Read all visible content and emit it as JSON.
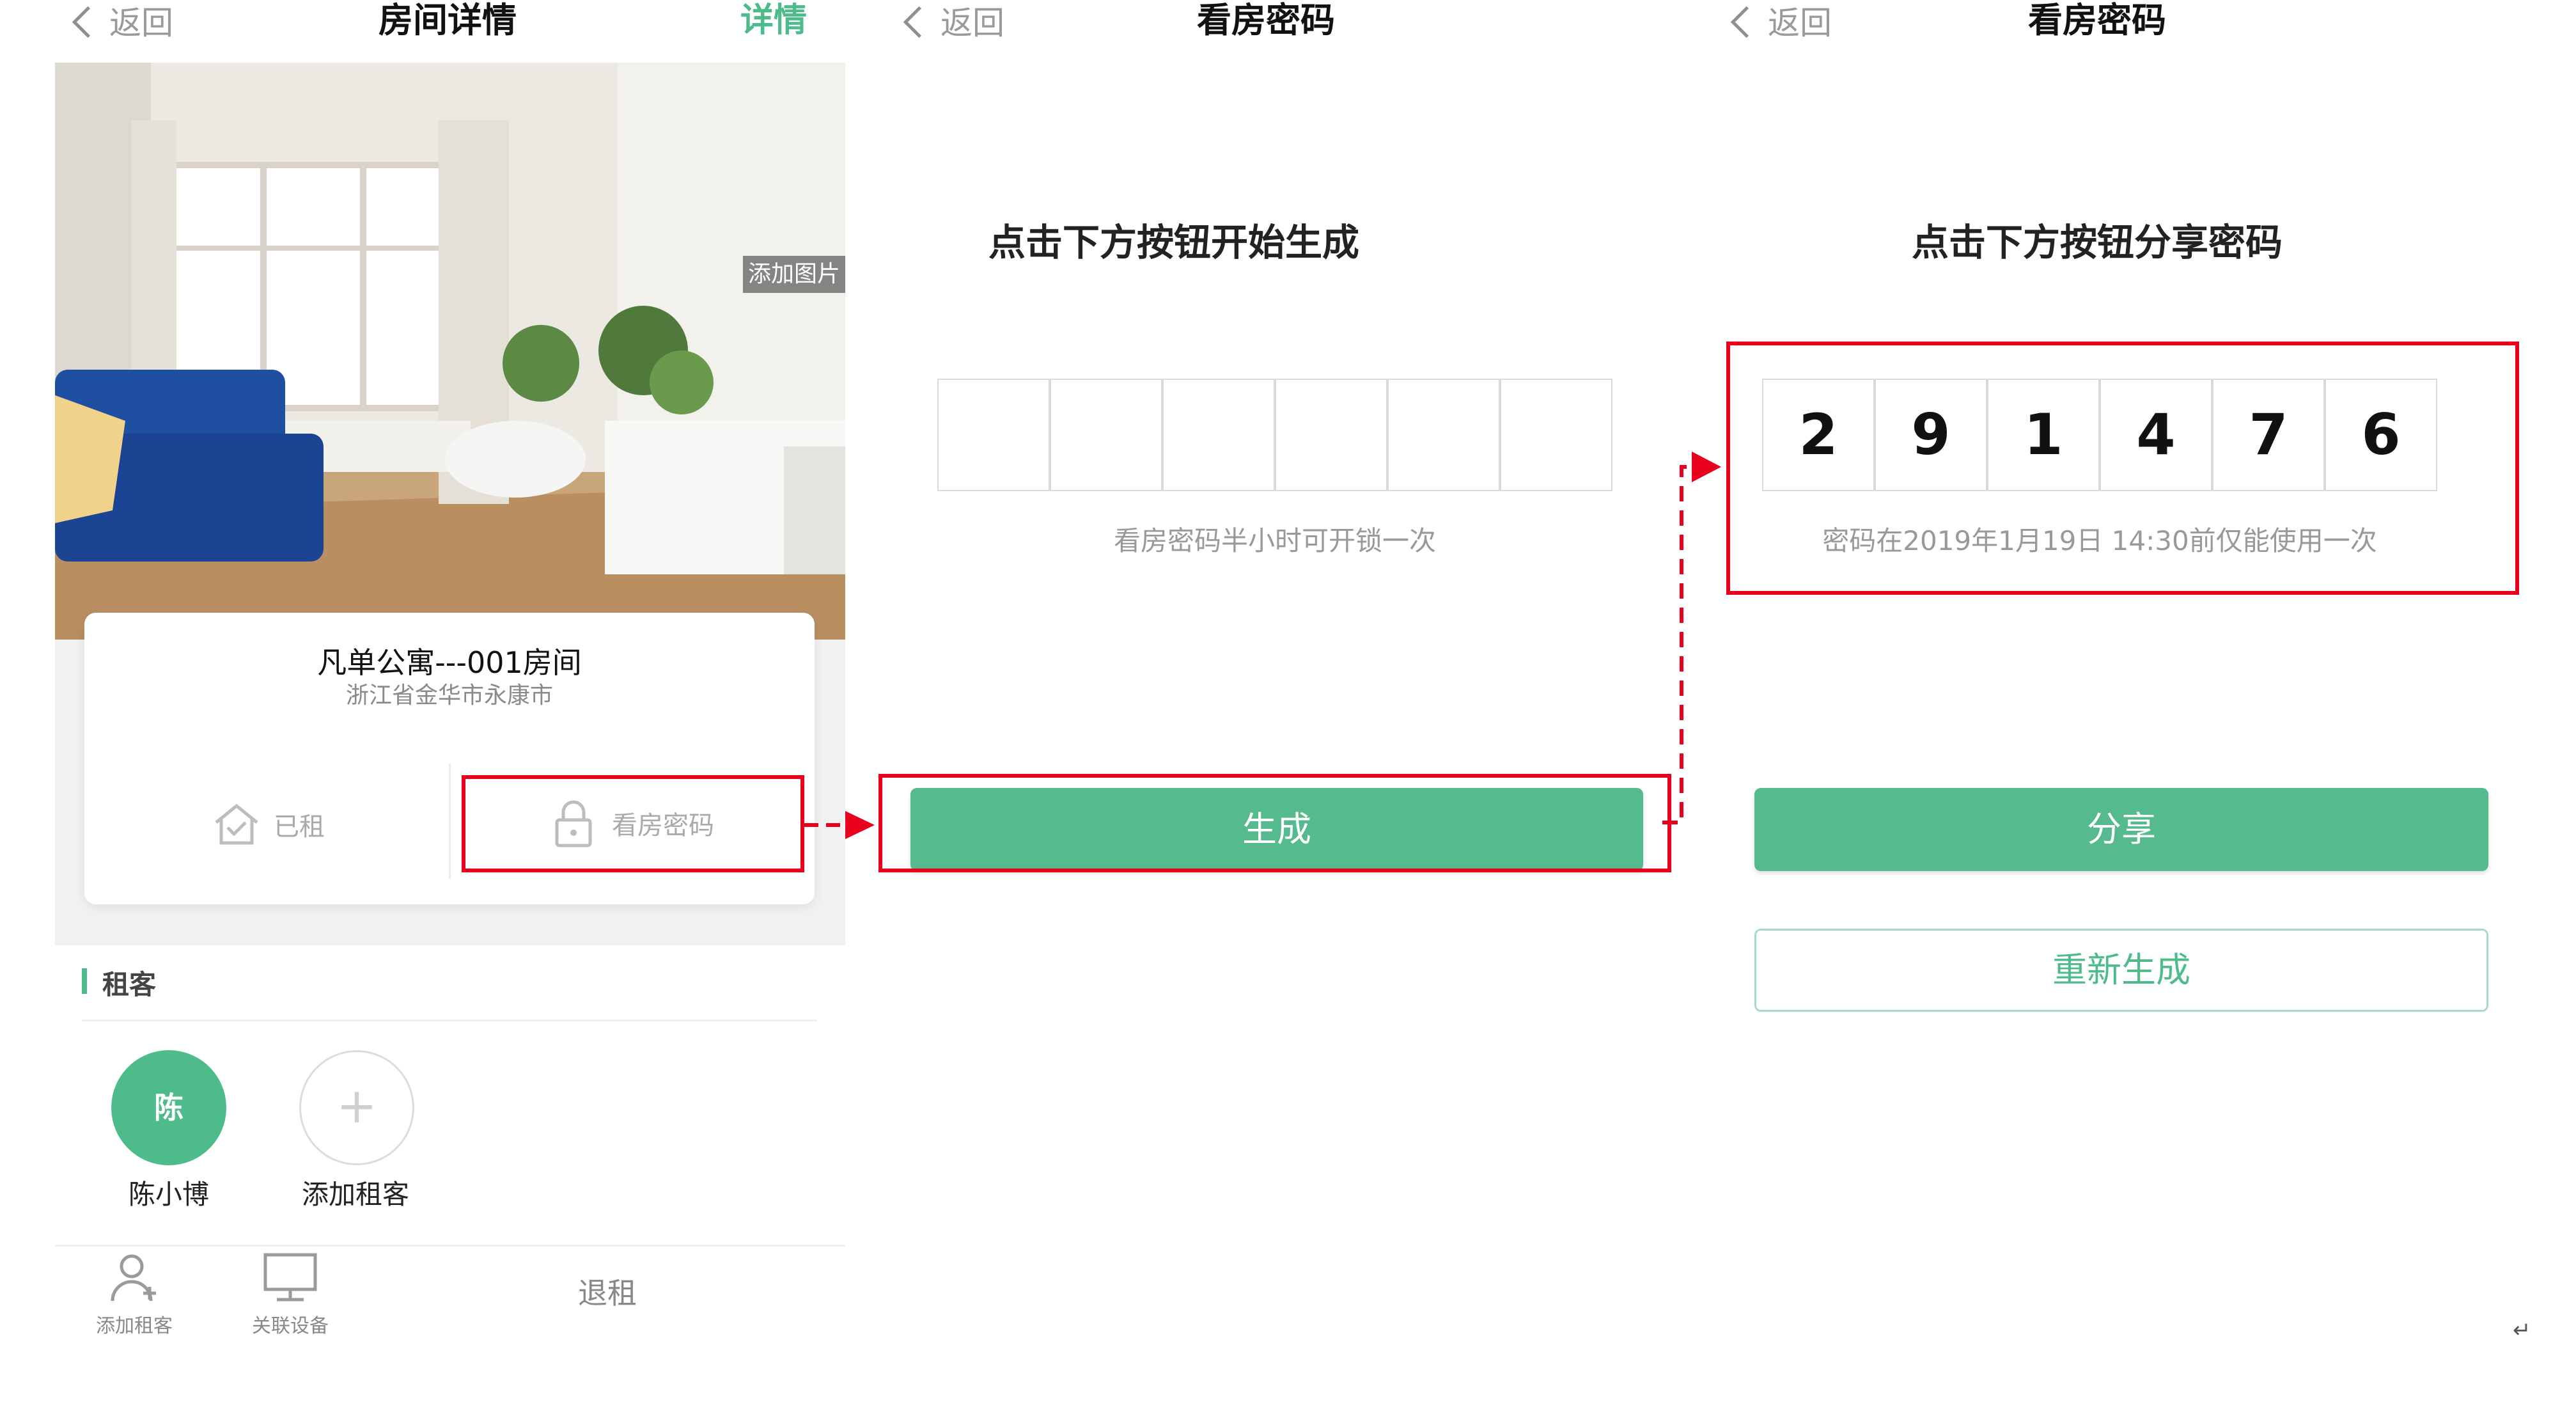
{
  "colors": {
    "accent": "#55bb8e",
    "highlight": "#e8001c"
  },
  "panel1": {
    "nav": {
      "back": "返回",
      "title": "房间详情",
      "right": "详情"
    },
    "add_photo": "添加图片",
    "room_name": "凡单公寓---001房间",
    "room_address": "浙江省金华市永康市",
    "actions": [
      {
        "label": "已租",
        "icon": "house-check-icon"
      },
      {
        "label": "看房密码",
        "icon": "lock-icon"
      }
    ],
    "tenants_section": "租客",
    "tenants": [
      {
        "avatar_text": "陈",
        "name": "陈小博"
      },
      {
        "avatar_text": "+",
        "name": "添加租客"
      }
    ],
    "bottom_bar": [
      {
        "label": "添加租客",
        "icon": "add-user-icon"
      },
      {
        "label": "关联设备",
        "icon": "monitor-icon"
      },
      {
        "label": "退租"
      }
    ]
  },
  "panel2": {
    "nav": {
      "back": "返回",
      "title": "看房密码"
    },
    "heading": "点击下方按钮开始生成",
    "digits": [
      "",
      "",
      "",
      "",
      "",
      ""
    ],
    "hint": "看房密码半小时可开锁一次",
    "generate_button": "生成"
  },
  "panel3": {
    "nav": {
      "back": "返回",
      "title": "看房密码"
    },
    "heading": "点击下方按钮分享密码",
    "digits": [
      "2",
      "9",
      "1",
      "4",
      "7",
      "6"
    ],
    "hint": "密码在2019年1月19日 14:30前仅能使用一次",
    "share_button": "分享",
    "regenerate_button": "重新生成"
  },
  "return_mark": "↵"
}
